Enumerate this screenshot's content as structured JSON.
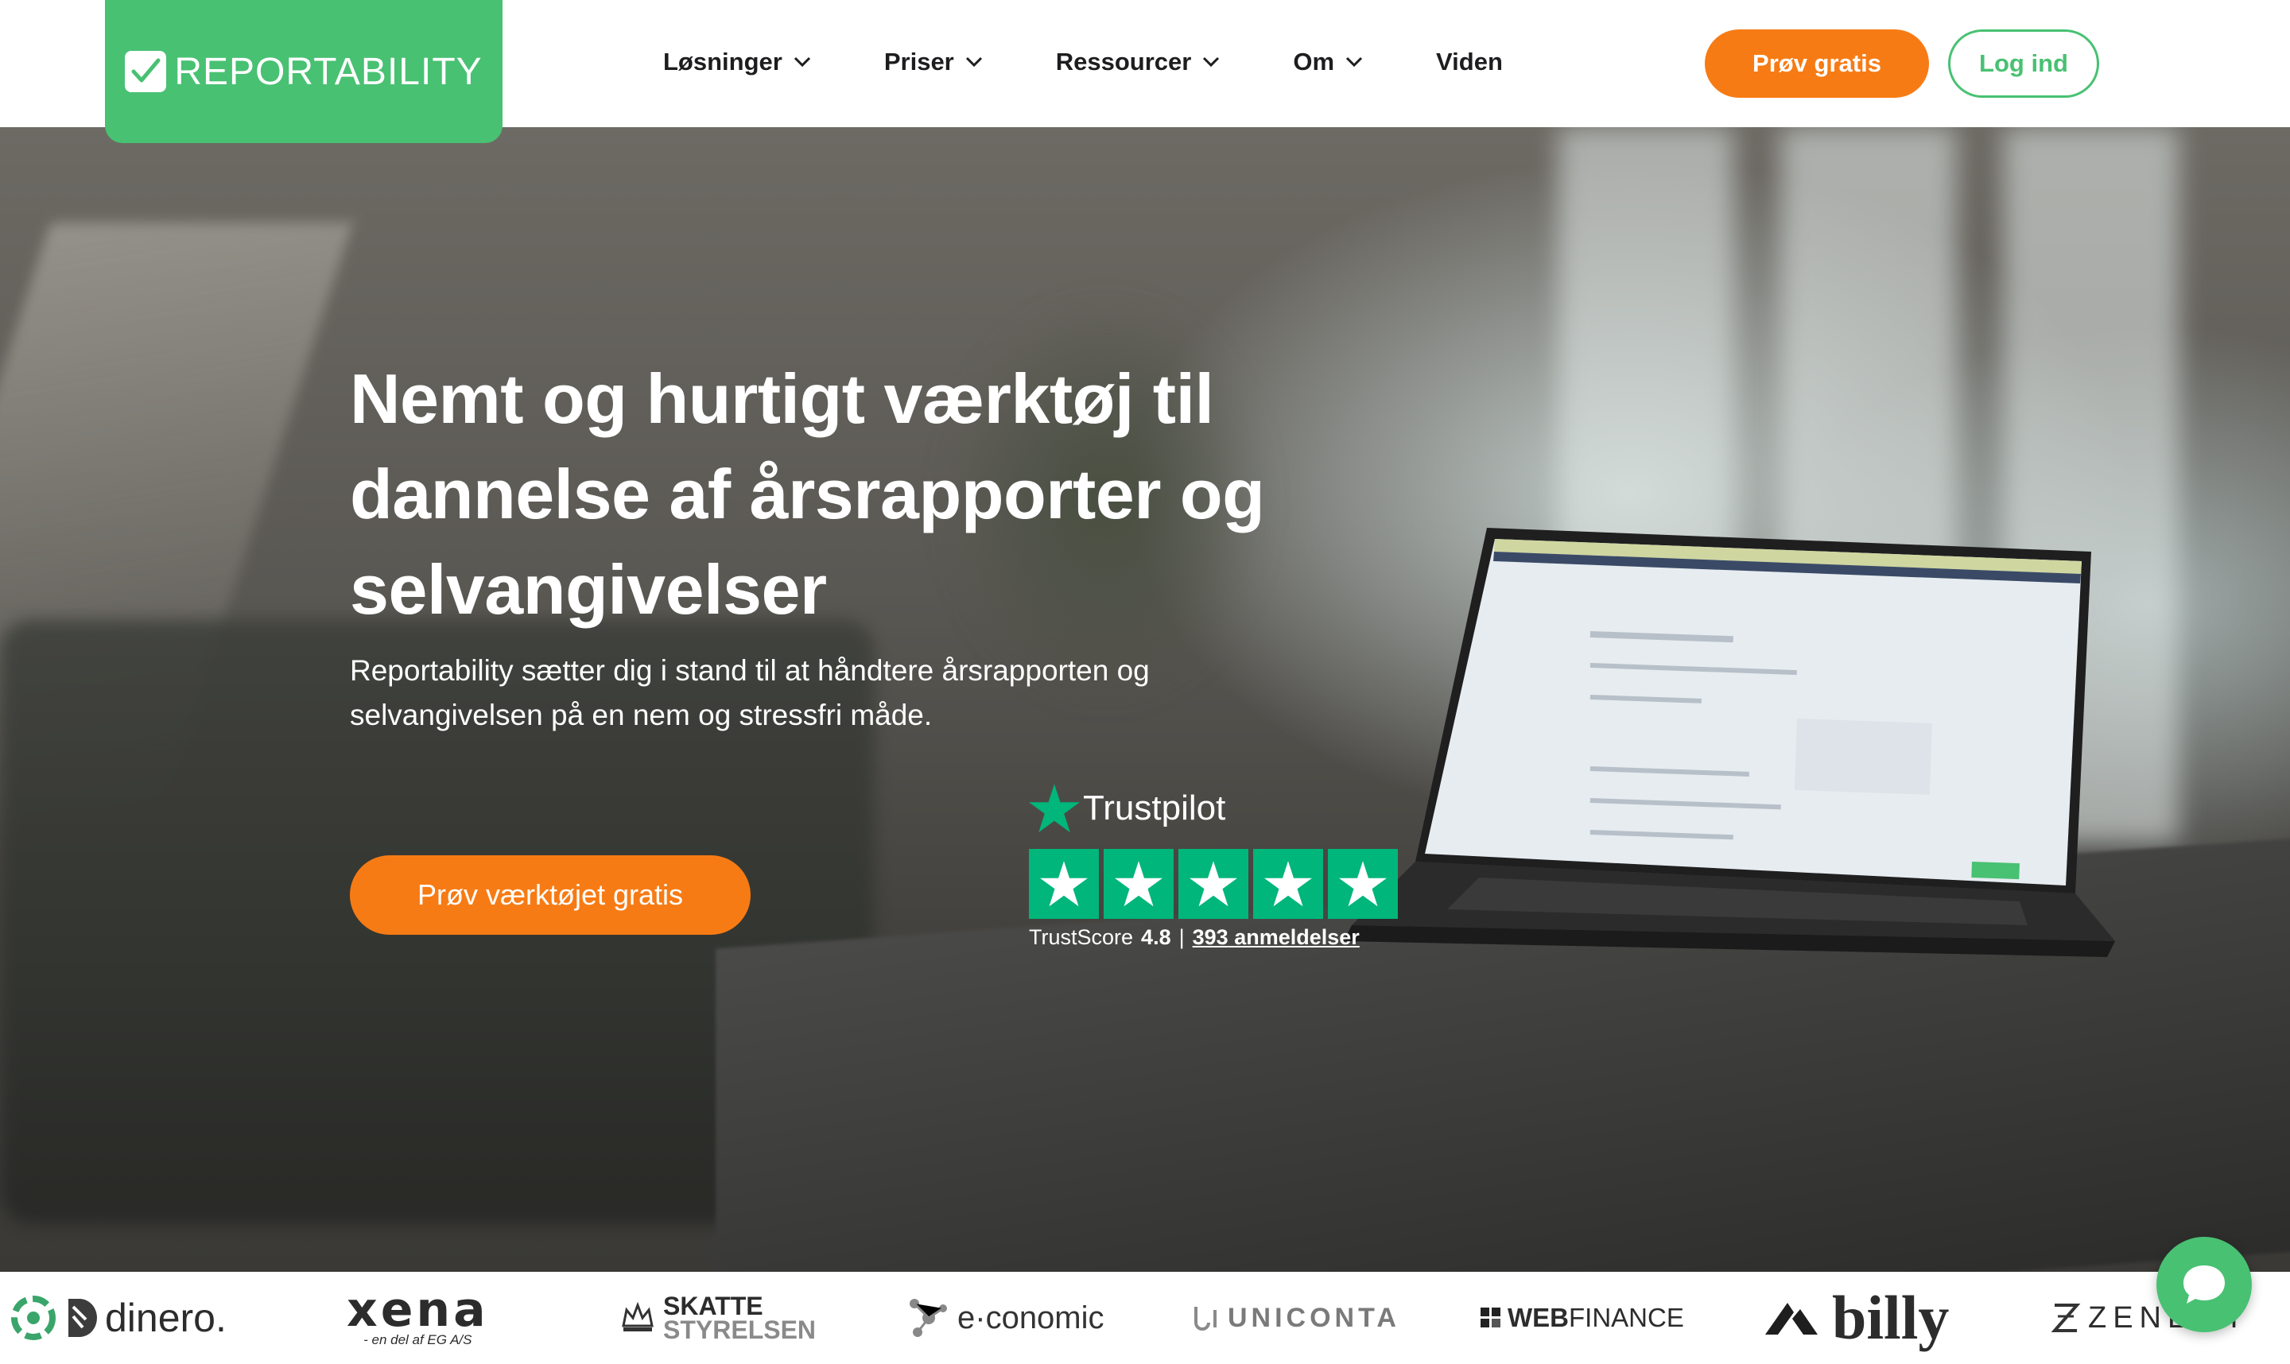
{
  "header": {
    "logo_text": "REPORTABILITY",
    "nav": [
      {
        "label": "Løsninger",
        "has_dropdown": true
      },
      {
        "label": "Priser",
        "has_dropdown": true
      },
      {
        "label": "Ressourcer",
        "has_dropdown": true
      },
      {
        "label": "Om",
        "has_dropdown": true
      },
      {
        "label": "Viden",
        "has_dropdown": false
      }
    ],
    "trial_button": "Prøv gratis",
    "login_button": "Log ind"
  },
  "hero": {
    "title": "Nemt og hurtigt værktøj til dannelse af årsrapporter og selvangivelser",
    "subtitle": "Reportability sætter dig i stand til at håndtere årsrapporten og selvangivelsen på en nem og stressfri måde.",
    "cta": "Prøv værktøjet gratis"
  },
  "trustpilot": {
    "brand": "Trustpilot",
    "stars": 5,
    "score_label": "TrustScore",
    "score_value": "4.8",
    "separator": "|",
    "review_count": "393",
    "review_label": "anmeldelser"
  },
  "partners": {
    "dinero": "dinero.",
    "xena": "xena",
    "xena_tagline": "- en del af EG A/S",
    "skat_line1": "SKATTE",
    "skat_line2": "STYRELSEN",
    "economic": "e·conomic",
    "uniconta": "UNICONTA",
    "webfinance_bold": "WEB",
    "webfinance_rest": "FINANCE",
    "billy": "billy",
    "zenegy": "ZENEGY"
  },
  "colors": {
    "brand_green": "#48c172",
    "accent_orange": "#f77b14",
    "trustpilot_green": "#00b67a"
  }
}
